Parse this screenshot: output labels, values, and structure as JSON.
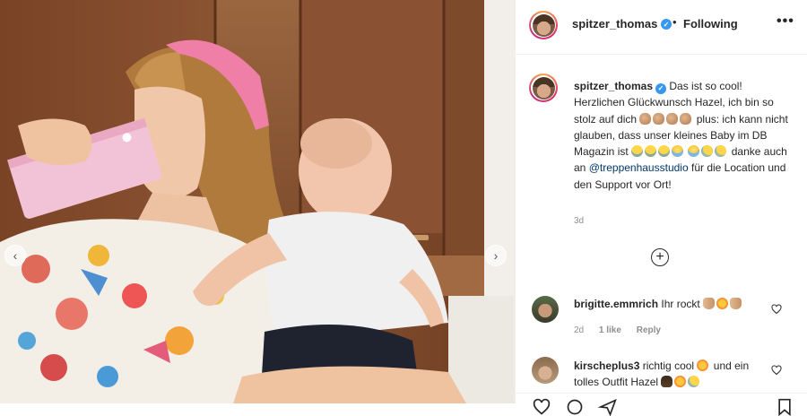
{
  "post": {
    "username": "spitzer_thomas",
    "follow_status": "Following",
    "header_separator": "•",
    "more_options_label": "•••",
    "caption": {
      "username": "spitzer_thomas",
      "seg1": "Das ist so cool! Herzlichen Glückwunsch Hazel, ich bin so stolz auf dich",
      "seg2": "plus: ich kann nicht glauben, dass unser kleines Baby im DB Magazin ist",
      "seg3": "danke auch an",
      "mention": "@treppenhausstudio",
      "seg4": "für die Location und den Support vor Ort!"
    },
    "time": "3d",
    "load_more_label": "+"
  },
  "photo_nav": {
    "prev": "‹",
    "next": "›"
  },
  "comments": [
    {
      "username": "brigitte.emmrich",
      "text": "Ihr rockt",
      "time": "2d",
      "likes": "1 like",
      "reply": "Reply"
    },
    {
      "username": "kirscheplus3",
      "text": "richtig cool",
      "text2": "und ein tolles Outfit Hazel"
    }
  ],
  "icons": {
    "verified": "verified-badge-icon",
    "more": "more-options-icon",
    "load_more": "plus-circle-icon",
    "heart": "heart-outline-icon",
    "action_bar": [
      "heart-icon",
      "comment-icon",
      "share-icon",
      "bookmark-icon"
    ]
  },
  "colors": {
    "verified": "#3897f0",
    "mention": "#00376b",
    "secondary_text": "#8e8e8e",
    "border": "#efefef"
  }
}
